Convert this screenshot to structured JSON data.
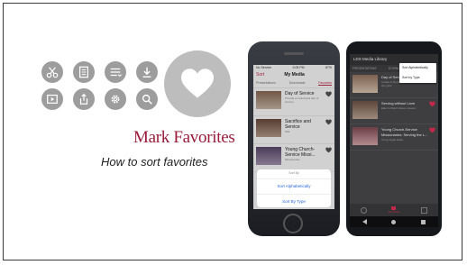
{
  "slide": {
    "title": "Mark Favorites",
    "subtitle": "How to sort favorites"
  },
  "colors": {
    "accent": "#9a1c3a",
    "icon_bg": "#9d9d9d",
    "heart_bg": "#bdbdbd"
  },
  "icons": [
    "scissors-icon",
    "document-icon",
    "list-icon",
    "download-icon",
    "play-icon",
    "share-icon",
    "gear-icon",
    "search-icon",
    "heart-icon"
  ],
  "iphone": {
    "status_left": "No Service",
    "status_time": "3:05 PM",
    "status_right": "87%",
    "back": "Sort",
    "nav_title": "My Media",
    "tabs": [
      "Presentations",
      "Downloads",
      "Favorites"
    ],
    "rows": [
      {
        "title": "Day of Service",
        "desc": "Provide a meaningful day of service"
      },
      {
        "title": "Sacrifice and Service",
        "desc": "Talk"
      },
      {
        "title": "Young Church-Service Missi...",
        "desc": "Missionaries"
      }
    ],
    "sheet_header": "Sort By",
    "sheet_options": [
      "Sort Alphabetically",
      "Sort By Type"
    ]
  },
  "android": {
    "app_title": "LDS Media Library",
    "tabs": [
      "PRESENTATIONS",
      "DOWNLOADS",
      "FAVORITES"
    ],
    "menu": [
      "Sort Alphabetically",
      "Sort by Type"
    ],
    "rows": [
      {
        "title": "Day of Service",
        "desc": "A sister in the Evergreen Ward shares how she grew"
      },
      {
        "title": "Serving without Love",
        "desc": "Elder Uchtdorf shares a lesson"
      },
      {
        "title": "Young Church-Service Missionaries: Serving the L...",
        "desc": "Young single adults"
      }
    ],
    "bottom_nav_active": "My Media"
  }
}
